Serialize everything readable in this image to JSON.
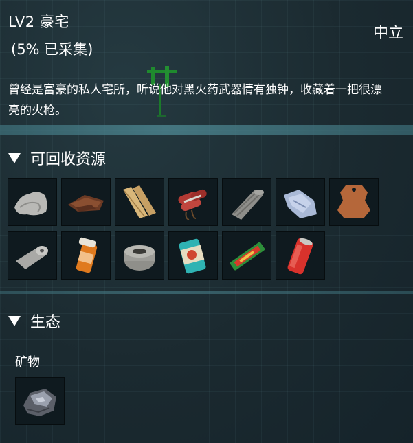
{
  "header": {
    "title": "LV2 豪宅",
    "progress_text": "(5% 已采集)",
    "faction": "中立"
  },
  "description": "曾经是富豪的私人宅所，听说他对黑火药武器情有独钟，收藏着一把很漂亮的火枪。",
  "resources": {
    "heading": "可回收资源",
    "items": [
      {
        "icon": "cloth-icon"
      },
      {
        "icon": "leather-scraps-icon"
      },
      {
        "icon": "wood-planks-icon"
      },
      {
        "icon": "dynamite-icon"
      },
      {
        "icon": "fabric-roll-icon"
      },
      {
        "icon": "plastic-sheet-icon"
      },
      {
        "icon": "leather-hide-icon"
      },
      {
        "icon": "toilet-paper-icon"
      },
      {
        "icon": "pill-bottle-icon"
      },
      {
        "icon": "duct-tape-icon"
      },
      {
        "icon": "food-can-icon"
      },
      {
        "icon": "snack-bar-icon"
      },
      {
        "icon": "soda-can-icon"
      }
    ]
  },
  "ecology": {
    "heading": "生态",
    "minerals_label": "矿物",
    "minerals": [
      {
        "icon": "ore-rock-icon"
      }
    ]
  }
}
